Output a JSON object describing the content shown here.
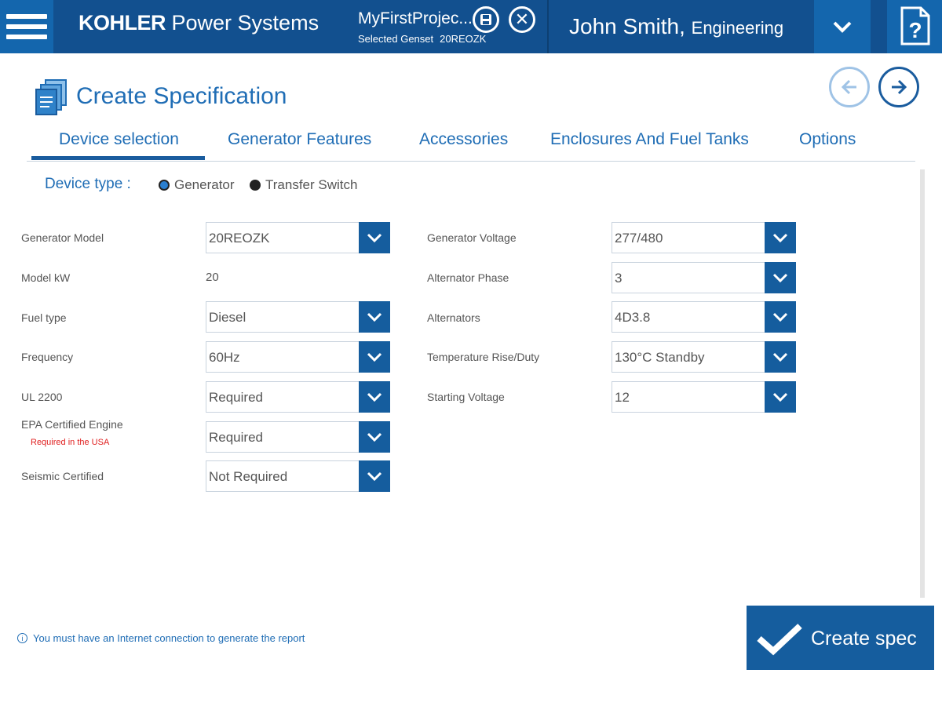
{
  "header": {
    "brand_bold": "KOHLER",
    "brand_rest": "Power Systems",
    "project_name": "MyFirstProjec...",
    "genset_label": "Selected Genset",
    "genset_value": "20REOZK",
    "user_name": "John Smith,",
    "user_dept": "Engineering",
    "icons": {
      "menu": "hamburger-menu-icon",
      "save": "save-icon",
      "close": "close-icon",
      "dropdown": "chevron-down-icon",
      "help": "help-icon"
    },
    "colors": {
      "bar": "#12508f",
      "accent": "#1466ad"
    }
  },
  "page": {
    "title": "Create Specification",
    "icon": "documents-icon",
    "back_icon": "arrow-left-icon",
    "forward_icon": "arrow-right-icon"
  },
  "tabs": [
    {
      "label": "Device selection",
      "active": true
    },
    {
      "label": "Generator Features",
      "active": false
    },
    {
      "label": "Accessories",
      "active": false
    },
    {
      "label": "Enclosures And Fuel Tanks",
      "active": false
    },
    {
      "label": "Options",
      "active": false
    }
  ],
  "device_type": {
    "label": "Device type :",
    "options": [
      "Generator",
      "Transfer Switch"
    ],
    "selected": "Generator"
  },
  "form_left": [
    {
      "label": "Generator Model",
      "value": "20REOZK",
      "type": "select"
    },
    {
      "label": "Model kW",
      "value": "20",
      "type": "static"
    },
    {
      "label": "Fuel type",
      "value": "Diesel",
      "type": "select"
    },
    {
      "label": "Frequency",
      "value": "60Hz",
      "type": "select"
    },
    {
      "label": "UL 2200",
      "value": "Required",
      "type": "select"
    },
    {
      "label": "EPA Certified Engine",
      "note": "Required in the USA",
      "value": "Required",
      "type": "select"
    },
    {
      "label": "Seismic Certified",
      "value": "Not Required",
      "type": "select"
    }
  ],
  "form_right": [
    {
      "label": "Generator Voltage",
      "value": "277/480",
      "type": "select"
    },
    {
      "label": "Alternator Phase",
      "value": "3",
      "type": "select"
    },
    {
      "label": "Alternators",
      "value": "4D3.8",
      "type": "select"
    },
    {
      "label": "Temperature Rise/Duty",
      "value": "130°C Standby",
      "type": "select"
    },
    {
      "label": "Starting Voltage",
      "value": "12",
      "type": "select"
    }
  ],
  "footer": {
    "info_icon": "info-icon",
    "info_text": "You must have an Internet connection to generate the report",
    "create_label": "Create spec",
    "create_icon": "checkmark-icon"
  }
}
